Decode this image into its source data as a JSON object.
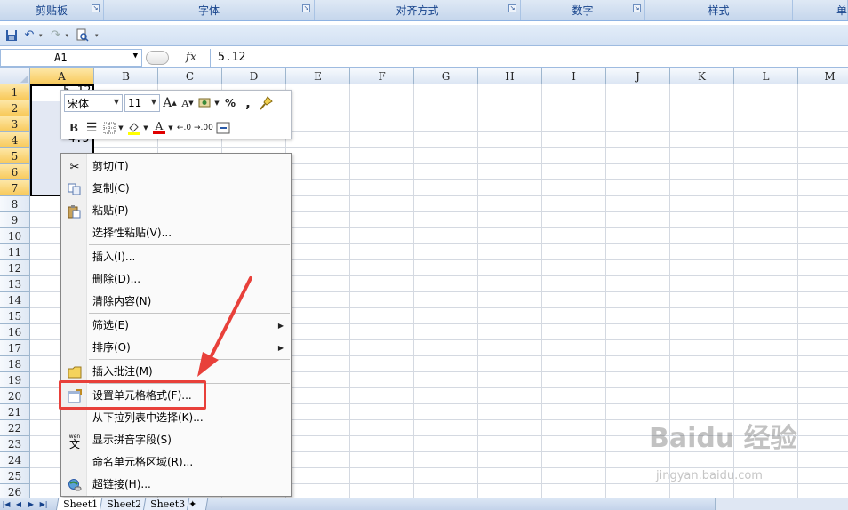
{
  "ribbon": {
    "groups": [
      "剪贴板",
      "字体",
      "对齐方式",
      "数字",
      "样式",
      "单"
    ]
  },
  "formula_bar": {
    "name_box": "A1",
    "fx_label": "fx",
    "value": "5.12"
  },
  "columns": [
    "A",
    "B",
    "C",
    "D",
    "E",
    "F",
    "G",
    "H",
    "I",
    "J",
    "K",
    "L",
    "M"
  ],
  "rows": [
    "1",
    "2",
    "3",
    "4",
    "5",
    "6",
    "7",
    "8",
    "9",
    "10",
    "11",
    "12",
    "13",
    "14",
    "15",
    "16",
    "17",
    "18",
    "19",
    "20",
    "21",
    "22",
    "23",
    "24",
    "25",
    "26"
  ],
  "cells": {
    "a1_partial": "5.12",
    "a4_partial": "4.5"
  },
  "mini_toolbar": {
    "font_name": "宋体",
    "font_size": "11",
    "bold": "B",
    "percent": "%",
    "comma": ",",
    "grow_font": "A",
    "shrink_font": "A",
    "font_color": "A",
    "increase_decimal": ".0",
    "decrease_decimal": ".00"
  },
  "context_menu": {
    "items": [
      {
        "label": "剪切(T)",
        "icon": "scissors-icon"
      },
      {
        "label": "复制(C)",
        "icon": "copy-icon"
      },
      {
        "label": "粘贴(P)",
        "icon": "paste-icon"
      },
      {
        "label": "选择性粘贴(V)...",
        "icon": ""
      },
      {
        "label": "插入(I)...",
        "icon": ""
      },
      {
        "label": "删除(D)...",
        "icon": ""
      },
      {
        "label": "清除内容(N)",
        "icon": ""
      },
      {
        "label": "筛选(E)",
        "icon": "",
        "submenu": true
      },
      {
        "label": "排序(O)",
        "icon": "",
        "submenu": true
      },
      {
        "label": "插入批注(M)",
        "icon": "comment-icon"
      },
      {
        "label": "设置单元格格式(F)...",
        "icon": "format-cells-icon"
      },
      {
        "label": "从下拉列表中选择(K)...",
        "icon": ""
      },
      {
        "label": "显示拼音字段(S)",
        "icon": "phonetic-icon"
      },
      {
        "label": "命名单元格区域(R)...",
        "icon": ""
      },
      {
        "label": "超链接(H)...",
        "icon": "hyperlink-icon"
      }
    ],
    "phonetic_glyph_top": "wén",
    "phonetic_glyph": "文"
  },
  "sheets": [
    "Sheet1",
    "Sheet2",
    "Sheet3"
  ],
  "watermark": {
    "brand": "Baidu 经验",
    "url": "jingyan.baidu.com"
  },
  "colors": {
    "highlight": "#e8403a",
    "selection_header": "#f8c95a",
    "ribbon_text": "#15428b"
  }
}
